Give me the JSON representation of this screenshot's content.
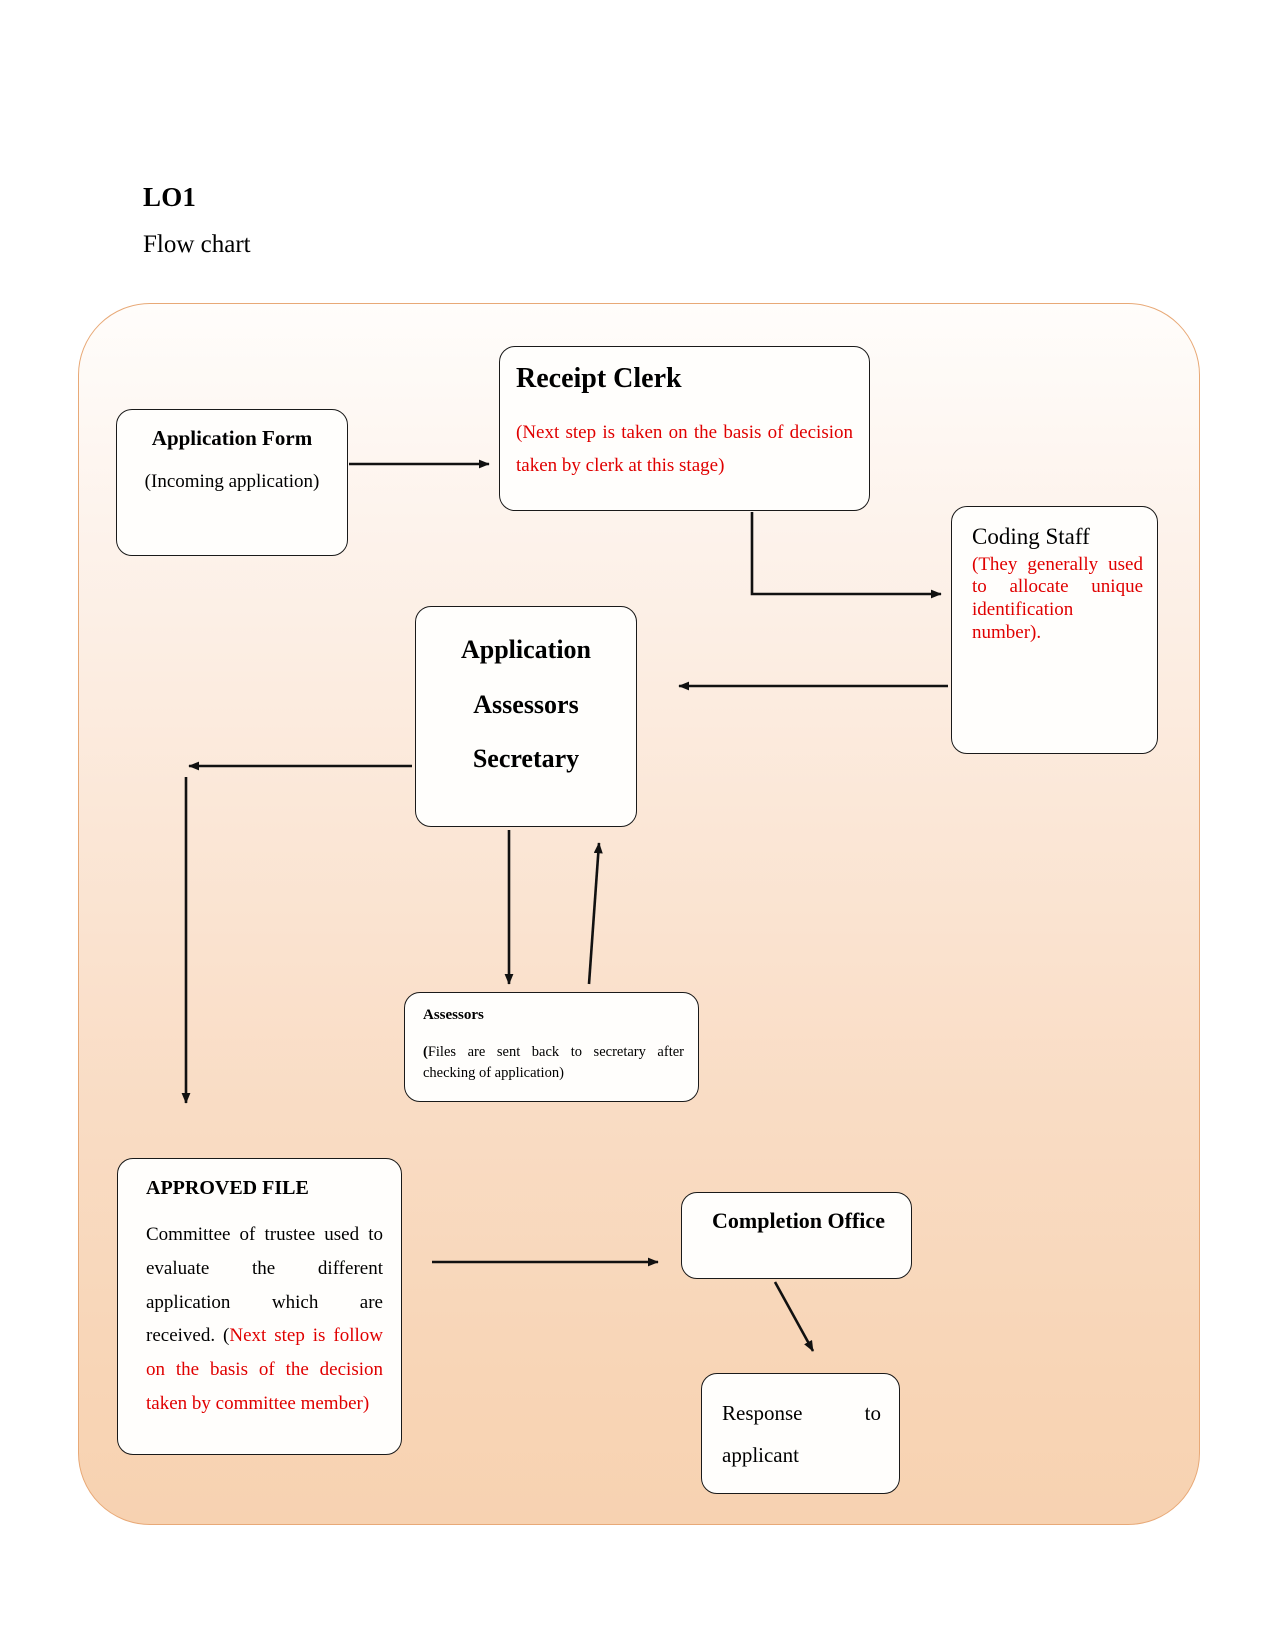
{
  "document": {
    "heading": "LO1",
    "subheading": "Flow chart"
  },
  "colors": {
    "accent_red": "#e00000",
    "panel_border": "#e8a977",
    "panel_gradient_top": "#fffdfb",
    "panel_gradient_bottom": "#f7d2b1",
    "node_border": "#1a1a1a",
    "node_fill": "#fffefc"
  },
  "flowchart": {
    "type": "flowchart",
    "nodes": [
      {
        "id": "application-form",
        "title": "Application Form",
        "body": "(Incoming application)",
        "body_color": "black"
      },
      {
        "id": "receipt-clerk",
        "title": "Receipt Clerk",
        "body": "(Next step is taken on the basis of decision taken by clerk at this stage)",
        "body_color": "red"
      },
      {
        "id": "coding-staff",
        "title": "Coding Staff",
        "body": "(They generally used to allocate unique identification number).",
        "body_color": "red"
      },
      {
        "id": "secretary",
        "title_line1": "Application",
        "title_line2": "Assessors",
        "title_line3": "Secretary"
      },
      {
        "id": "assessors",
        "title": "Assessors",
        "body_bold_prefix": "(",
        "body": "Files are sent back to secretary after checking of application)",
        "body_color": "black"
      },
      {
        "id": "approved-file",
        "title": "APPROVED FILE",
        "body_black": "Committee of trustee used to evaluate the different application which are received. (",
        "body_red": "Next step is follow on the basis of the decision taken by committee member)"
      },
      {
        "id": "completion-office",
        "title": "Completion Office"
      },
      {
        "id": "response",
        "body": "Response to applicant"
      }
    ],
    "edges": [
      {
        "from": "application-form",
        "to": "receipt-clerk",
        "style": "straight-right"
      },
      {
        "from": "receipt-clerk",
        "to": "coding-staff",
        "style": "elbow-down-right"
      },
      {
        "from": "coding-staff",
        "to": "secretary",
        "style": "straight-left"
      },
      {
        "from": "secretary",
        "to": "approved-file",
        "style": "elbow-left-down"
      },
      {
        "from": "secretary",
        "to": "assessors",
        "style": "straight-down"
      },
      {
        "from": "assessors",
        "to": "secretary",
        "style": "straight-up"
      },
      {
        "from": "approved-file",
        "to": "completion-office",
        "style": "straight-right"
      },
      {
        "from": "completion-office",
        "to": "response",
        "style": "diagonal-down-right"
      }
    ]
  }
}
